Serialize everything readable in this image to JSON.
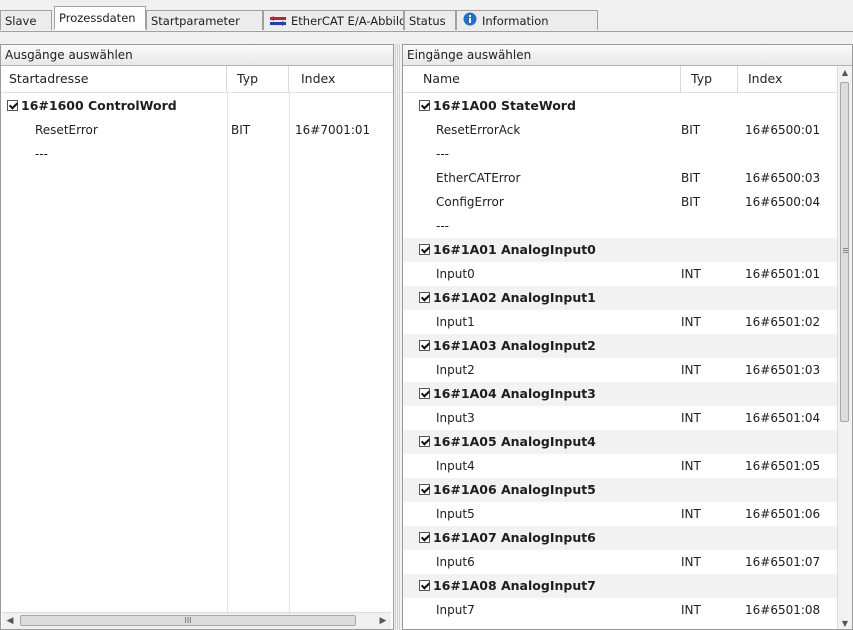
{
  "tabs": [
    {
      "label": "Slave",
      "active": false
    },
    {
      "label": "Prozessdaten",
      "active": true
    },
    {
      "label": "Startparameter",
      "active": false
    },
    {
      "label": "EtherCAT E/A-Abbild",
      "active": false,
      "icon": "ethercat-io-icon"
    },
    {
      "label": "Status",
      "active": false
    },
    {
      "label": "Information",
      "active": false,
      "icon": "info-icon"
    }
  ],
  "outputs": {
    "title": "Ausgänge auswählen",
    "columns": [
      "Startadresse",
      "Typ",
      "Index"
    ],
    "rows": [
      {
        "group": true,
        "checked": true,
        "name": "16#1600 ControlWord",
        "type": "",
        "index": ""
      },
      {
        "group": false,
        "name": "ResetError",
        "type": "BIT",
        "index": "16#7001:01"
      },
      {
        "group": false,
        "name": "---",
        "type": "",
        "index": ""
      }
    ]
  },
  "inputs": {
    "title": "Eingänge auswählen",
    "columns": [
      "Name",
      "Typ",
      "Index"
    ],
    "rows": [
      {
        "group": true,
        "checked": true,
        "name": "16#1A00 StateWord",
        "type": "",
        "index": ""
      },
      {
        "group": false,
        "name": "ResetErrorAck",
        "type": "BIT",
        "index": "16#6500:01"
      },
      {
        "group": false,
        "name": "---",
        "type": "",
        "index": ""
      },
      {
        "group": false,
        "name": "EtherCATError",
        "type": "BIT",
        "index": "16#6500:03"
      },
      {
        "group": false,
        "name": "ConfigError",
        "type": "BIT",
        "index": "16#6500:04"
      },
      {
        "group": false,
        "name": "---",
        "type": "",
        "index": ""
      },
      {
        "group": true,
        "checked": true,
        "name": "16#1A01 AnalogInput0",
        "type": "",
        "index": ""
      },
      {
        "group": false,
        "name": "Input0",
        "type": "INT",
        "index": "16#6501:01"
      },
      {
        "group": true,
        "checked": true,
        "name": "16#1A02 AnalogInput1",
        "type": "",
        "index": ""
      },
      {
        "group": false,
        "name": "Input1",
        "type": "INT",
        "index": "16#6501:02"
      },
      {
        "group": true,
        "checked": true,
        "name": "16#1A03 AnalogInput2",
        "type": "",
        "index": ""
      },
      {
        "group": false,
        "name": "Input2",
        "type": "INT",
        "index": "16#6501:03"
      },
      {
        "group": true,
        "checked": true,
        "name": "16#1A04 AnalogInput3",
        "type": "",
        "index": ""
      },
      {
        "group": false,
        "name": "Input3",
        "type": "INT",
        "index": "16#6501:04"
      },
      {
        "group": true,
        "checked": true,
        "name": "16#1A05 AnalogInput4",
        "type": "",
        "index": ""
      },
      {
        "group": false,
        "name": "Input4",
        "type": "INT",
        "index": "16#6501:05"
      },
      {
        "group": true,
        "checked": true,
        "name": "16#1A06 AnalogInput5",
        "type": "",
        "index": ""
      },
      {
        "group": false,
        "name": "Input5",
        "type": "INT",
        "index": "16#6501:06"
      },
      {
        "group": true,
        "checked": true,
        "name": "16#1A07 AnalogInput6",
        "type": "",
        "index": ""
      },
      {
        "group": false,
        "name": "Input6",
        "type": "INT",
        "index": "16#6501:07"
      },
      {
        "group": true,
        "checked": true,
        "name": "16#1A08 AnalogInput7",
        "type": "",
        "index": ""
      },
      {
        "group": false,
        "name": "Input7",
        "type": "INT",
        "index": "16#6501:08"
      }
    ]
  },
  "scrollbar_glyph": "III",
  "colors": {
    "group_row_shade": "#f2f2f2",
    "info_icon": "#1e6fd0",
    "ethercat_icon_red": "#cc1f1f",
    "ethercat_icon_blue": "#1f3fb8"
  }
}
